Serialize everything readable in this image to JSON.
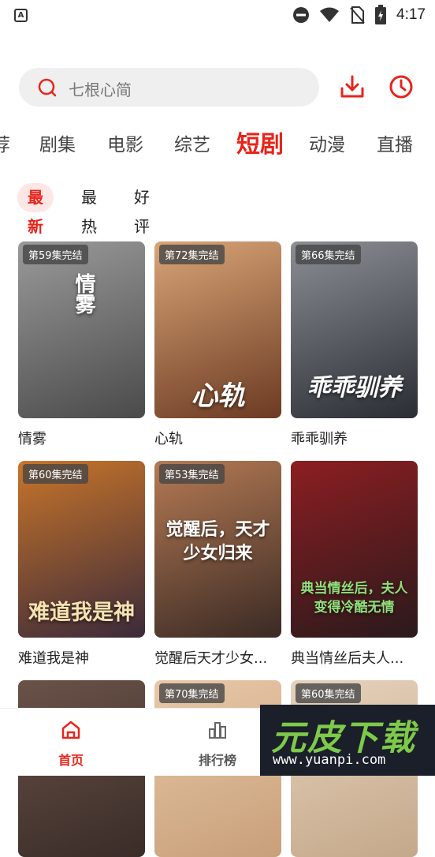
{
  "status_bar": {
    "time": "4:17",
    "app_icon_letter": "A",
    "icons": [
      "do-not-disturb-icon",
      "wifi-icon",
      "no-sim-icon",
      "battery-charging-icon"
    ]
  },
  "search": {
    "placeholder": "七根心简"
  },
  "toolbar": {
    "download_icon": "download-icon",
    "history_icon": "history-clock-icon"
  },
  "channels": [
    "荐",
    "剧集",
    "电影",
    "综艺",
    "短剧",
    "动漫",
    "直播"
  ],
  "channels_active": "短剧",
  "sort": {
    "items": [
      "最新",
      "最热",
      "好评"
    ],
    "active": "最新"
  },
  "cards": [
    {
      "badge": "第59集完结",
      "title": "情雾",
      "poster_text": "情雾",
      "colors": [
        "#4a4a4a",
        "#9a9a9a"
      ]
    },
    {
      "badge": "第72集完结",
      "title": "心轨",
      "poster_text": "心轨",
      "colors": [
        "#6b3a22",
        "#d9a577"
      ]
    },
    {
      "badge": "第66集完结",
      "title": "乖乖驯养",
      "poster_text": "乖乖驯养",
      "colors": [
        "#2a2d33",
        "#8b8f95"
      ]
    },
    {
      "badge": "第60集完结",
      "title": "难道我是神",
      "poster_text": "难道我是神",
      "colors": [
        "#3b2a3a",
        "#c8752a"
      ]
    },
    {
      "badge": "第53集完结",
      "title": "觉醒后天才少女...",
      "poster_text": "觉醒后，天才少女归来",
      "colors": [
        "#3a2a24",
        "#b57a54"
      ]
    },
    {
      "badge": "",
      "title": "典当情丝后夫人...",
      "poster_text": "典当情丝后，夫人变得冷酷无情",
      "colors": [
        "#2a1a1c",
        "#8c1e22"
      ]
    },
    {
      "badge": "",
      "title": "",
      "poster_text": "",
      "colors": [
        "#3a2c28",
        "#6a5248"
      ]
    },
    {
      "badge": "第70集完结",
      "title": "",
      "poster_text": "",
      "colors": [
        "#c8a07a",
        "#e8c8a8"
      ]
    },
    {
      "badge": "第60集完结",
      "title": "",
      "poster_text": "",
      "colors": [
        "#c4a88a",
        "#e6d2bc"
      ]
    }
  ],
  "bottom_nav": {
    "home": "首页",
    "ranking": "排行榜"
  },
  "watermark": {
    "main": "元皮下载",
    "sub": "www.yuanpi.com"
  },
  "accent_color": "#e8241b"
}
